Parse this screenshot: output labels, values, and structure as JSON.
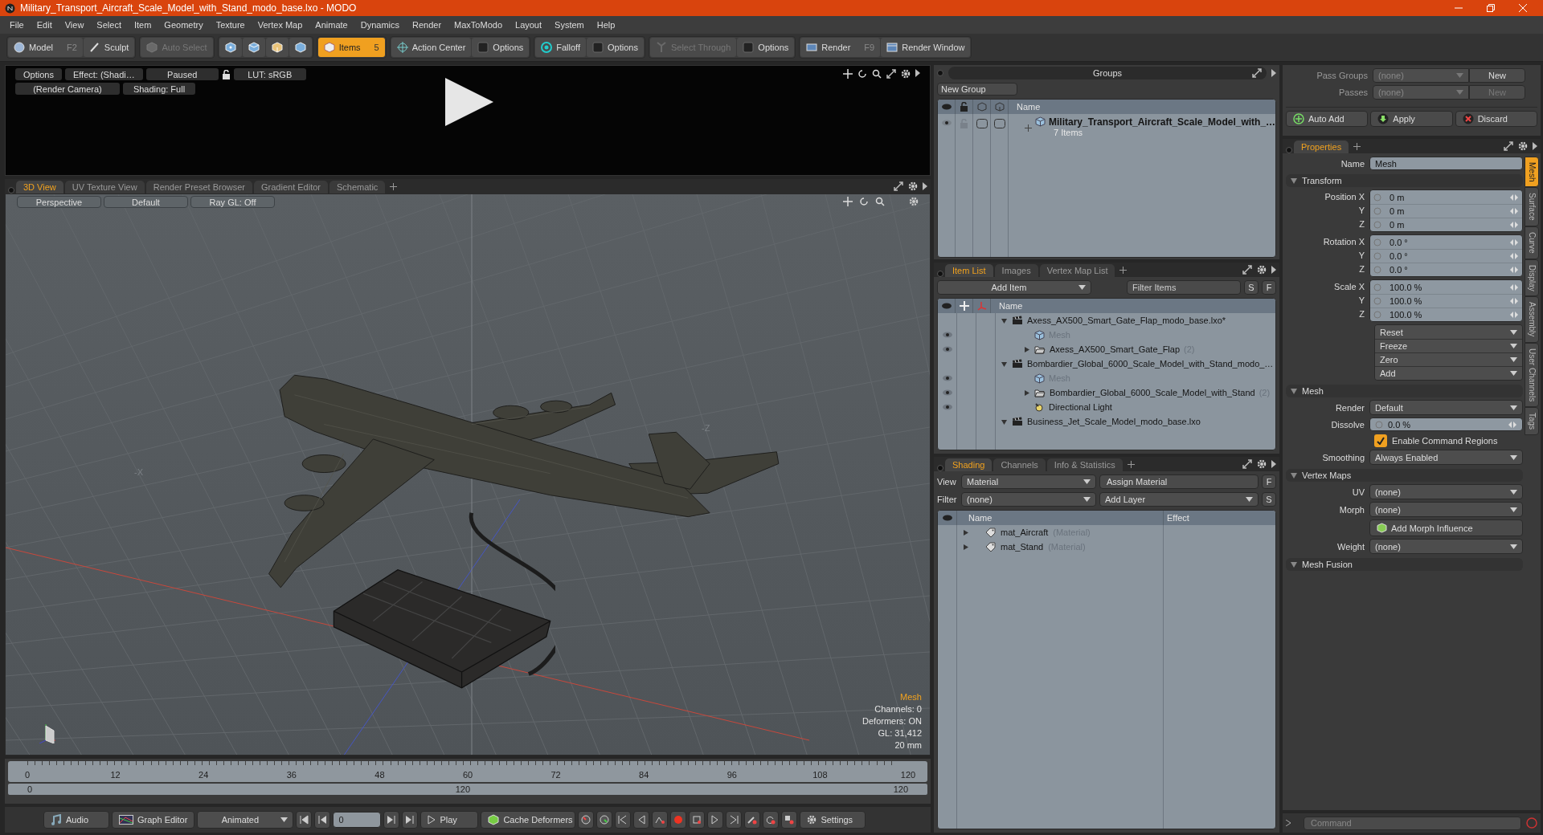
{
  "window": {
    "title": "Military_Transport_Aircraft_Scale_Model_with_Stand_modo_base.lxo - MODO"
  },
  "menu": [
    "File",
    "Edit",
    "View",
    "Select",
    "Item",
    "Geometry",
    "Texture",
    "Vertex Map",
    "Animate",
    "Dynamics",
    "Render",
    "MaxToModo",
    "Layout",
    "System",
    "Help"
  ],
  "toolbar": [
    [
      {
        "label": "Model",
        "shortcut": "F2",
        "selected": false,
        "disabled": false
      },
      {
        "label": "Sculpt",
        "selected": false,
        "disabled": false
      }
    ],
    [
      {
        "label": "Auto Select",
        "selected": false,
        "disabled": true
      }
    ],
    [
      {
        "selected": false,
        "disabled": false
      },
      {
        "selected": false,
        "disabled": false
      },
      {
        "selected": false,
        "disabled": false
      },
      {
        "selected": false,
        "disabled": false
      }
    ],
    [
      {
        "label": "Items",
        "shortcut": "5",
        "selected": true,
        "disabled": false
      }
    ],
    [
      {
        "label": "Action Center",
        "selected": false,
        "disabled": false
      },
      {
        "label": "Options",
        "selected": false,
        "disabled": false
      }
    ],
    [
      {
        "label": "Falloff",
        "selected": false,
        "disabled": false
      },
      {
        "label": "Options",
        "selected": false,
        "disabled": false
      }
    ],
    [
      {
        "label": "Select Through",
        "selected": false,
        "disabled": true
      },
      {
        "label": "Options",
        "selected": false,
        "disabled": false
      }
    ],
    [
      {
        "label": "Render",
        "shortcut": "F9",
        "selected": false,
        "disabled": false
      },
      {
        "label": "Render Window",
        "selected": false,
        "disabled": false
      }
    ]
  ],
  "preview": {
    "row_1": [
      "Options",
      "Effect: (Shadi…",
      "Paused",
      "LUT: sRGB"
    ],
    "row_2": [
      "(Render Camera)",
      "Shading: Full"
    ]
  },
  "viewport": {
    "tabs": [
      {
        "label": "3D View",
        "selected": true
      },
      {
        "label": "UV Texture View",
        "selected": false
      },
      {
        "label": "Render Preset Browser",
        "selected": false
      },
      {
        "label": "Gradient Editor",
        "selected": false
      },
      {
        "label": "Schematic",
        "selected": false
      }
    ],
    "view_buttons": [
      "Perspective",
      "Default",
      "Ray GL: Off"
    ],
    "axis_labels": [
      "-X",
      "-Z"
    ],
    "info": {
      "title": "Mesh",
      "lines": [
        "Channels: 0",
        "Deformers: ON",
        "GL: 31,412",
        "20 mm"
      ]
    }
  },
  "timeline": {
    "ticks": [
      "0",
      "12",
      "24",
      "36",
      "48",
      "60",
      "72",
      "84",
      "96",
      "108",
      "120"
    ],
    "range": [
      "0",
      "120",
      "120"
    ]
  },
  "transport": {
    "audio": "Audio",
    "graph_editor": "Graph Editor",
    "mode": "Animated",
    "frame": "0",
    "play": "Play",
    "cache": "Cache Deformers",
    "settings": "Settings"
  },
  "groups": {
    "title": "Groups",
    "new_group": "New Group",
    "column": "Name",
    "rows": [
      {
        "name": "Military_Transport_Aircraft_Scale_Model_with_…",
        "count": "7 Items",
        "expanded": false
      }
    ]
  },
  "item_list": {
    "tabs": [
      {
        "label": "Item List",
        "selected": true
      },
      {
        "label": "Images",
        "selected": false
      },
      {
        "label": "Vertex Map List",
        "selected": false
      }
    ],
    "add_item": "Add Item",
    "filter_placeholder": "Filter Items",
    "buttons": [
      "S",
      "F"
    ],
    "column": "Name",
    "items": [
      {
        "kind": "scene",
        "name": "Axess_AX500_Smart_Gate_Flap_modo_base.lxo*",
        "expanded": true,
        "children": [
          {
            "kind": "mesh",
            "name": "Mesh"
          },
          {
            "kind": "group",
            "name": "Axess_AX500_Smart_Gate_Flap",
            "count": "(2)",
            "expanded": false
          }
        ]
      },
      {
        "kind": "scene",
        "name": "Bombardier_Global_6000_Scale_Model_with_Stand_modo_…",
        "expanded": true,
        "children": [
          {
            "kind": "mesh",
            "name": "Mesh"
          },
          {
            "kind": "group",
            "name": "Bombardier_Global_6000_Scale_Model_with_Stand",
            "count": "(2)",
            "expanded": false
          },
          {
            "kind": "light",
            "name": "Directional Light"
          }
        ]
      },
      {
        "kind": "scene",
        "name": "Business_Jet_Scale_Model_modo_base.lxo",
        "expanded": true
      }
    ]
  },
  "shading": {
    "tabs": [
      {
        "label": "Shading",
        "selected": true
      },
      {
        "label": "Channels",
        "selected": false
      },
      {
        "label": "Info & Statistics",
        "selected": false
      }
    ],
    "view": {
      "label": "View",
      "value": "Material"
    },
    "assign": "Assign Material",
    "f_button": "F",
    "filter": {
      "label": "Filter",
      "value": "(none)"
    },
    "add_layer": "Add Layer",
    "s_button": "S",
    "columns": [
      "Name",
      "Effect"
    ],
    "rows": [
      {
        "name": "mat_Aircraft",
        "type": "(Material)",
        "expanded": false
      },
      {
        "name": "mat_Stand",
        "type": "(Material)",
        "expanded": false
      }
    ]
  },
  "passes": {
    "pass_groups": {
      "label": "Pass Groups",
      "value": "(none)",
      "button": "New",
      "disabled": false
    },
    "passes": {
      "label": "Passes",
      "value": "(none)",
      "button": "New",
      "disabled": true
    },
    "actions": [
      "Auto Add",
      "Apply",
      "Discard"
    ]
  },
  "properties": {
    "tabs": [
      {
        "label": "Properties",
        "selected": true
      }
    ],
    "name": {
      "label": "Name",
      "value": "Mesh"
    },
    "sections": [
      {
        "title": "Transform",
        "rows": [
          {
            "kind": "vector",
            "rows": [
              {
                "label": "Position X",
                "value": "0 m"
              },
              {
                "label": "Y",
                "value": "0 m"
              },
              {
                "label": "Z",
                "value": "0 m"
              }
            ]
          },
          {
            "kind": "vector",
            "rows": [
              {
                "label": "Rotation X",
                "value": "0.0 °"
              },
              {
                "label": "Y",
                "value": "0.0 °"
              },
              {
                "label": "Z",
                "value": "0.0 °"
              }
            ]
          },
          {
            "kind": "vector",
            "rows": [
              {
                "label": "Scale X",
                "value": "100.0 %"
              },
              {
                "label": "Y",
                "value": "100.0 %"
              },
              {
                "label": "Z",
                "value": "100.0 %"
              }
            ]
          },
          {
            "kind": "menu_buttons",
            "items": [
              "Reset",
              "Freeze",
              "Zero",
              "Add"
            ]
          }
        ]
      },
      {
        "title": "Mesh",
        "rows": [
          {
            "kind": "dropdown",
            "label": "Render",
            "value": "Default"
          },
          {
            "kind": "field",
            "label": "Dissolve",
            "value": "0.0 %"
          },
          {
            "kind": "checkbox",
            "label": "Enable Command Regions",
            "checked": true
          },
          {
            "kind": "dropdown",
            "label": "Smoothing",
            "value": "Always Enabled"
          }
        ]
      },
      {
        "title": "Vertex Maps",
        "rows": [
          {
            "kind": "dropdown",
            "label": "UV",
            "value": "(none)"
          },
          {
            "kind": "dropdown",
            "label": "Morph",
            "value": "(none)"
          },
          {
            "kind": "button",
            "label": "Add Morph Influence"
          },
          {
            "kind": "dropdown",
            "label": "Weight",
            "value": "(none)"
          }
        ]
      },
      {
        "title": "Mesh Fusion"
      }
    ],
    "side_tabs": [
      {
        "label": "Mesh",
        "selected": true
      },
      {
        "label": "Surface",
        "selected": false
      },
      {
        "label": "Curve",
        "selected": false
      },
      {
        "label": "Display",
        "selected": false
      },
      {
        "label": "Assembly",
        "selected": false
      },
      {
        "label": "User Channels",
        "selected": false
      },
      {
        "label": "Tags",
        "selected": false
      }
    ]
  },
  "command": {
    "placeholder": "Command"
  }
}
